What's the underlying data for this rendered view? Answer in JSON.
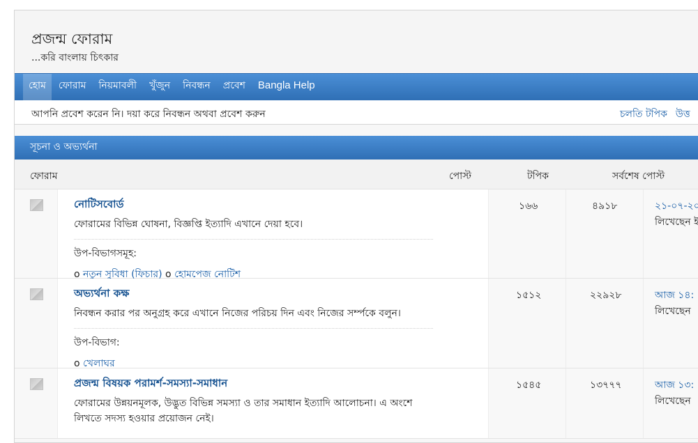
{
  "site": {
    "title": "প্রজন্ম ফোরাম",
    "tagline": "...করি বাংলায় চিৎকার"
  },
  "nav": {
    "items": [
      {
        "label": "হোম"
      },
      {
        "label": "ফোরাম"
      },
      {
        "label": "নিয়মাবলী"
      },
      {
        "label": "খুঁজুন"
      },
      {
        "label": "নিবন্ধন"
      },
      {
        "label": "প্রবেশ"
      },
      {
        "label": "Bangla Help"
      }
    ],
    "active_index": 0
  },
  "login_bar": {
    "message": "আপনি প্রবেশ করেন নি। দয়া করে নিবন্ধন অথবা প্রবেশ করুন",
    "links": [
      "চলতি টপিক",
      "উত্ত"
    ]
  },
  "category": {
    "title": "সূচনা ও অভ্যর্থনা",
    "columns": {
      "forum": "ফোরাম",
      "posts": "পোস্ট",
      "topics": "টপিক",
      "last_post": "সর্বশেষ পোস্ট"
    },
    "forums": [
      {
        "title": "নোটিসবোর্ড",
        "description": "ফোরামের বিভিন্ন ঘোষনা, বিজ্ঞপ্তি ইত্যাদি এখানে দেয়া হবে।",
        "sub_label": "উপ-বিভাগসমূহ:",
        "subforums": [
          "নতুন সুবিধা (ফিচার)",
          "হোমপেজ নোটিশ"
        ],
        "posts": "১৬৬",
        "topics": "৪৯১৮",
        "last_post_date": "২১-০৭-২০",
        "last_post_by": "লিখেছেন ই"
      },
      {
        "title": "অভ্যর্থনা কক্ষ",
        "description": "নিবন্ধন করার পর অনুগ্রহ করে এখানে নিজের পরিচয় দিন এবং নিজের সর্ম্পকে বলুন।",
        "sub_label": "উপ-বিভাগ:",
        "subforums": [
          "খেলাঘর"
        ],
        "posts": "১৫১২",
        "topics": "২২৯২৮",
        "last_post_date": "আজ ১৪:",
        "last_post_by": "লিখেছেন"
      },
      {
        "title": "প্রজন্ম বিষয়ক পরামর্শ-সমস্যা-সমাধান",
        "description": "ফোরামের উন্নয়নমূলক, উদ্ভুত বিভিন্ন সমস্যা ও তার সমাধান ইত্যাদি আলোচনা। এ অংশে লিখতে সদস্য হওয়ার প্রয়োজন নেই।",
        "posts": "১৫৪৫",
        "topics": "১৩৭৭৭",
        "last_post_date": "আজ ১৩:",
        "last_post_by": "লিখেছেন"
      }
    ]
  },
  "bullet_char": "o"
}
